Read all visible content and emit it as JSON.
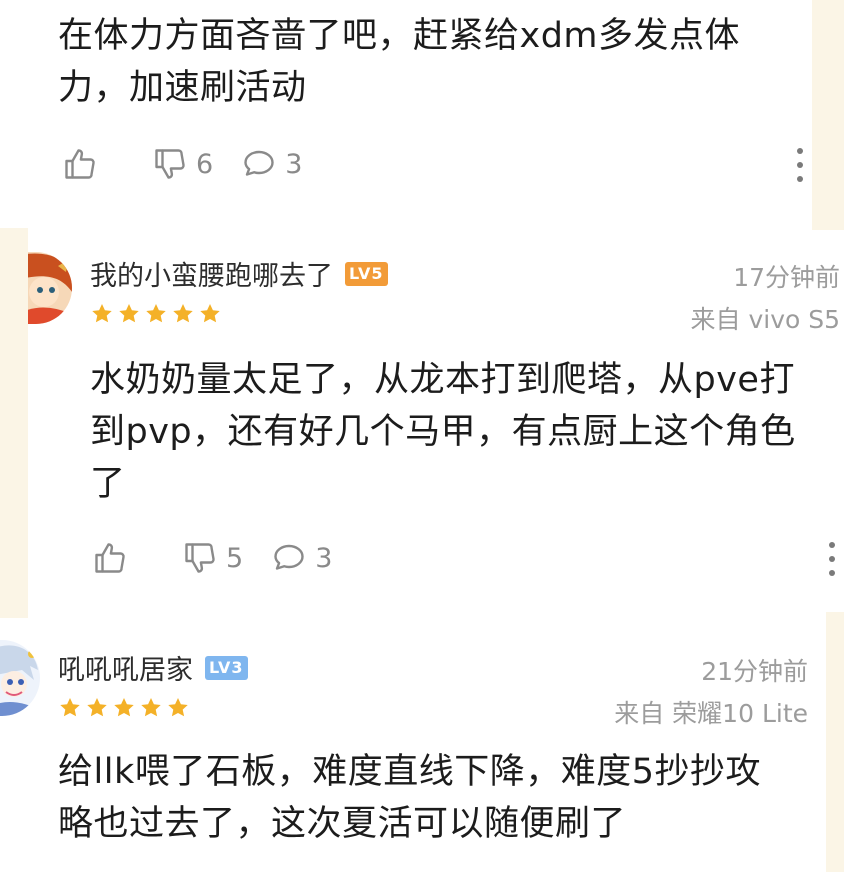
{
  "colors": {
    "star": "#f4b128",
    "lv5": "#f29b38",
    "lv3": "#7fb6ef",
    "icon_gray": "#8a8a8a",
    "strip": "#fbf5e6"
  },
  "comments": [
    {
      "text_lines": [
        "在体力方面吝啬了吧，赶紧给xdm多发点体",
        "力，加速刷活动"
      ],
      "actions": {
        "like_icon": "thumbs-up-icon",
        "dislike_icon": "thumbs-down-icon",
        "dislikes": "6",
        "reply_icon": "comment-bubble-icon",
        "replies": "3",
        "more_icon": "more-vertical-icon"
      }
    },
    {
      "username": "我的小蛮腰跑哪去了",
      "level": "LV5",
      "rating": 5,
      "time": "17分钟前",
      "device": "来自 vivo S5",
      "text_lines": [
        "水奶奶量太足了，从龙本打到爬塔，从pve打",
        "到pvp，还有好几个马甲，有点厨上这个角色",
        "了"
      ],
      "actions": {
        "dislikes": "5",
        "replies": "3"
      }
    },
    {
      "username": "吼吼吼居家",
      "level": "LV3",
      "rating": 5,
      "time": "21分钟前",
      "device": "来自 荣耀10 Lite",
      "text_lines": [
        "给llk喂了石板，难度直线下降，难度5抄抄攻",
        "略也过去了，这次夏活可以随便刷了"
      ]
    }
  ]
}
